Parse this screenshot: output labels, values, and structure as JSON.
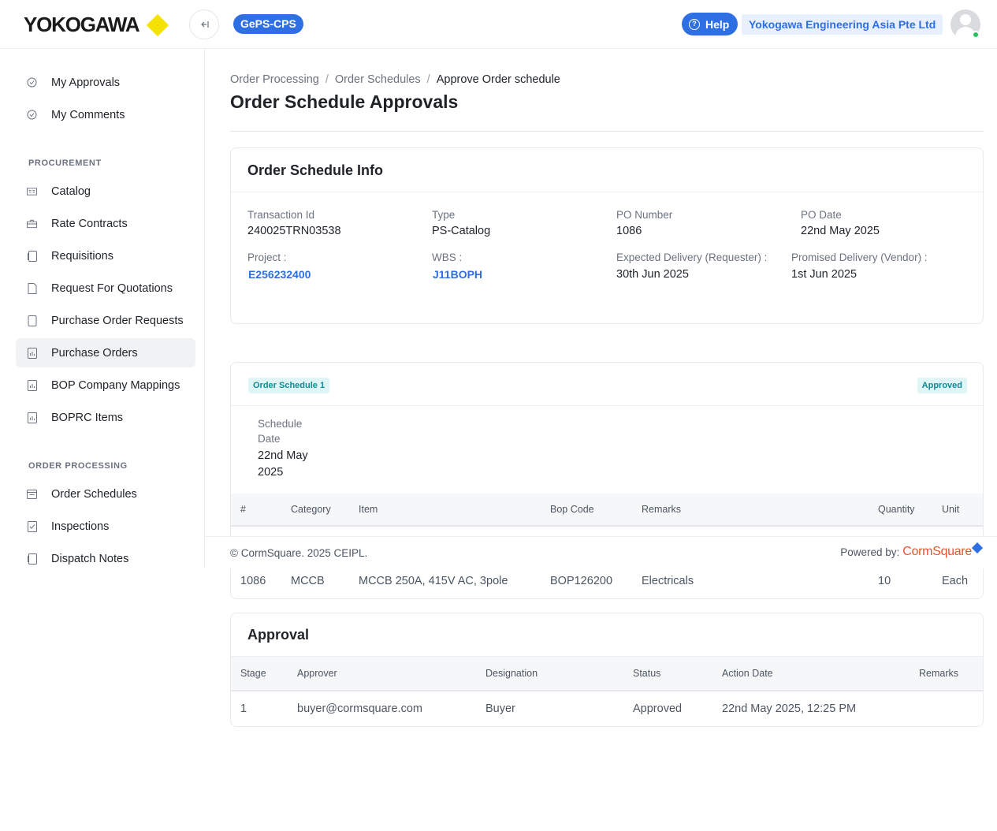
{
  "header": {
    "logo_text": "YOKOGAWA",
    "collapse_icon": "sidebar-collapse-icon",
    "app_badge": "GePS-CPS",
    "help_label": "Help",
    "company": "Yokogawa Engineering Asia Pte Ltd"
  },
  "sidebar": {
    "top_items": [
      {
        "label": "My Approvals",
        "icon": "check-circle-icon"
      },
      {
        "label": "My Comments",
        "icon": "check-circle-icon"
      }
    ],
    "procurement_title": "PROCUREMENT",
    "procurement_items": [
      {
        "label": "Catalog",
        "icon": "catalog-icon"
      },
      {
        "label": "Rate Contracts",
        "icon": "briefcase-icon"
      },
      {
        "label": "Requisitions",
        "icon": "document-icon"
      },
      {
        "label": "Request For Quotations",
        "icon": "file-icon"
      },
      {
        "label": "Purchase Order Requests",
        "icon": "document-icon"
      },
      {
        "label": "Purchase Orders",
        "icon": "report-icon",
        "active": true
      },
      {
        "label": "BOP Company Mappings",
        "icon": "report-icon"
      },
      {
        "label": "BOPRC Items",
        "icon": "report-icon"
      }
    ],
    "order_processing_title": "ORDER PROCESSING",
    "order_processing_items": [
      {
        "label": "Order Schedules",
        "icon": "calendar-icon"
      },
      {
        "label": "Inspections",
        "icon": "checklist-icon"
      },
      {
        "label": "Dispatch Notes",
        "icon": "note-icon"
      }
    ]
  },
  "breadcrumb": {
    "items": [
      "Order Processing",
      "Order Schedules"
    ],
    "separator": "/",
    "current": "Approve Order schedule"
  },
  "page_title": "Order Schedule Approvals",
  "info_card": {
    "title": "Order Schedule Info",
    "transaction_id_label": "Transaction Id",
    "transaction_id": "240025TRN03538",
    "type_label": "Type",
    "type": "PS-Catalog",
    "po_number_label": "PO Number",
    "po_number": "1086",
    "po_date_label": "PO Date",
    "po_date": "22nd May 2025",
    "project_label": "Project :",
    "project": "E256232400",
    "wbs_label": "WBS :",
    "wbs": "J11BOPH",
    "expected_delivery_label": "Expected Delivery (Requester) :",
    "expected_delivery": "30th Jun 2025",
    "promised_delivery_label": "Promised Delivery (Vendor) :",
    "promised_delivery": "1st Jun 2025"
  },
  "schedule_card": {
    "tag": "Order Schedule 1",
    "status": "Approved",
    "schedule_date_label_1": "Schedule",
    "schedule_date_label_2": "Date",
    "schedule_date_1": "22nd May",
    "schedule_date_2": "2025",
    "columns": [
      "#",
      "Category",
      "Item",
      "Bop Code",
      "Remarks",
      "Quantity",
      "Unit"
    ],
    "row": {
      "num": "1086",
      "category": "MCCB",
      "item": "MCCB 250A, 415V AC, 3pole",
      "bop_code": "BOP126200",
      "remarks": "Electricals",
      "quantity": "10",
      "unit": "Each"
    }
  },
  "approval_card": {
    "title": "Approval",
    "columns": [
      "Stage",
      "Approver",
      "Designation",
      "Status",
      "Action Date",
      "Remarks"
    ],
    "row": {
      "stage": "1",
      "approver": "buyer@cormsquare.com",
      "designation": "Buyer",
      "status": "Approved",
      "action_date": "22nd May 2025, 12:25 PM",
      "remarks": ""
    }
  },
  "footer": {
    "copyright": "© CormSquare. 2025 CEIPL.",
    "powered_label": "Powered by:",
    "brand": "CormSquare"
  },
  "colors": {
    "accent": "#2f6fe4",
    "teal": "#0e8c96",
    "logo_diamond": "#f5e100",
    "online": "#22c55e"
  }
}
